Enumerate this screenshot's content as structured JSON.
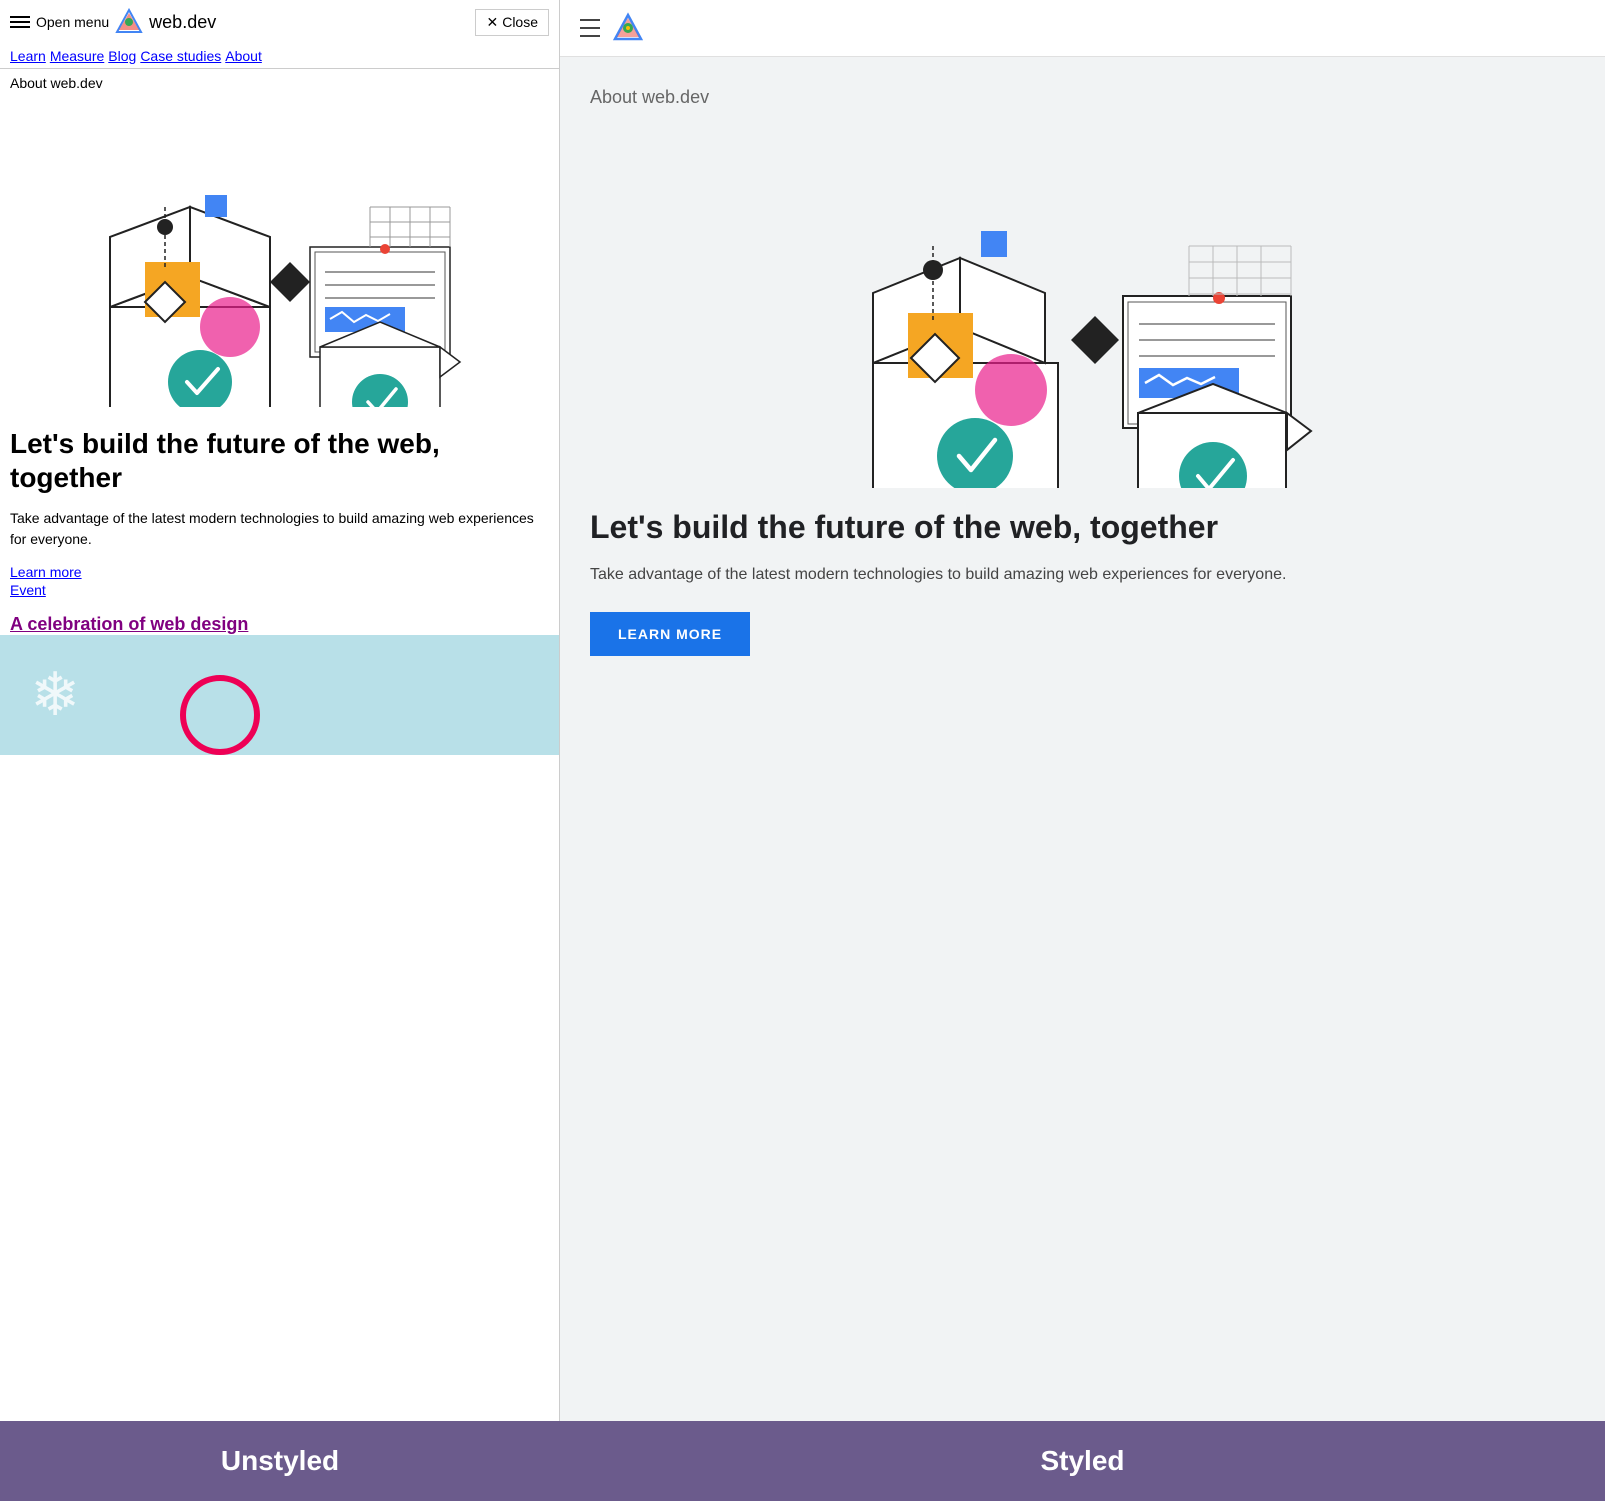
{
  "left": {
    "open_menu": "Open menu",
    "site_title": "web.dev",
    "close": "Close",
    "nav_links": [
      "Learn",
      "Measure",
      "Blog",
      "Case studies",
      "About"
    ],
    "about_label": "About web.dev",
    "heading": "Let's build the future of the web, together",
    "description": "Take advantage of the latest modern technologies to build amazing web experiences for everyone.",
    "learn_more": "Learn more",
    "event": "Event",
    "celebration_link": "A celebration of web design"
  },
  "right": {
    "about_label": "About web.dev",
    "heading": "Let's build the future of the web, together",
    "description": "Take advantage of the latest modern technologies to build amazing web experiences for everyone.",
    "learn_more_btn": "LEARN MORE"
  },
  "bottom": {
    "unstyled_label": "Unstyled",
    "styled_label": "Styled"
  },
  "colors": {
    "link_blue": "#0000EE",
    "purple": "#800080",
    "btn_blue": "#1a73e8",
    "label_bg": "#6b5b8c"
  }
}
